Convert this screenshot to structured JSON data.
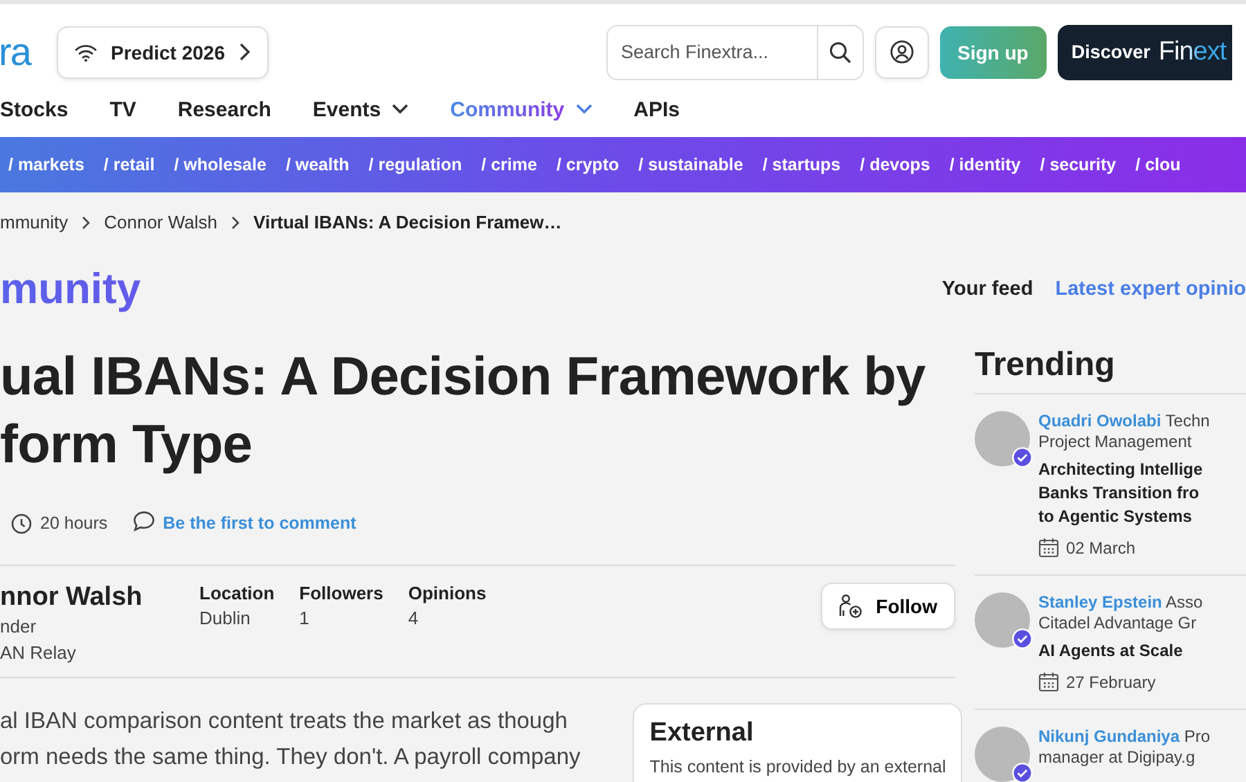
{
  "header": {
    "logo": "ra",
    "predict": "Predict 2026",
    "search_placeholder": "Search Finextra...",
    "signup": "Sign up",
    "discover": "Discover",
    "discover_logo": "Finext"
  },
  "nav": [
    {
      "label": "Stocks",
      "dropdown": false,
      "selected": false
    },
    {
      "label": "TV",
      "dropdown": false,
      "selected": false
    },
    {
      "label": "Research",
      "dropdown": false,
      "selected": false
    },
    {
      "label": "Events",
      "dropdown": true,
      "selected": false
    },
    {
      "label": "Community",
      "dropdown": true,
      "selected": true
    },
    {
      "label": "APIs",
      "dropdown": false,
      "selected": false
    }
  ],
  "categories": [
    "/ markets",
    "/ retail",
    "/ wholesale",
    "/ wealth",
    "/ regulation",
    "/ crime",
    "/ crypto",
    "/ sustainable",
    "/ startups",
    "/ devops",
    "/ identity",
    "/ security",
    "/ clou"
  ],
  "breadcrumb": [
    "mmunity",
    "Connor Walsh",
    "Virtual IBANs: A Decision Framew…"
  ],
  "section_title": "munity",
  "feed_tabs": [
    {
      "label": "Your feed",
      "selected": false
    },
    {
      "label": "Latest expert opinio",
      "selected": true
    }
  ],
  "article": {
    "title_lines": [
      "ual IBANs: A Decision Framework by",
      "form Type"
    ],
    "age": "20 hours",
    "comment_link": "Be the first to comment",
    "author": {
      "name": "nnor Walsh",
      "role": "nder",
      "company": "AN Relay"
    },
    "stats": [
      {
        "label": "Location",
        "value": "Dublin"
      },
      {
        "label": "Followers",
        "value": "1"
      },
      {
        "label": "Opinions",
        "value": "4"
      }
    ],
    "follow": "Follow",
    "body_lines": [
      "al IBAN comparison content treats the market as though",
      "orm needs the same thing. They don't. A payroll company"
    ],
    "external": {
      "title": "External",
      "text": "This content is provided by an external"
    }
  },
  "trending": {
    "title": "Trending",
    "items": [
      {
        "name": "Quadri Owolabi",
        "role_lines": [
          "Techn",
          "Project Management"
        ],
        "headline_lines": [
          "Architecting Intellige",
          "Banks Transition fro",
          "to Agentic Systems"
        ],
        "date": "02 March"
      },
      {
        "name": "Stanley Epstein",
        "role_lines": [
          "Asso",
          "Citadel Advantage Gr"
        ],
        "headline_lines": [
          "AI Agents at Scale"
        ],
        "date": "27 February"
      },
      {
        "name": "Nikunj Gundaniya",
        "role_lines": [
          "Pro",
          "manager at Digipay.g"
        ]
      }
    ]
  }
}
